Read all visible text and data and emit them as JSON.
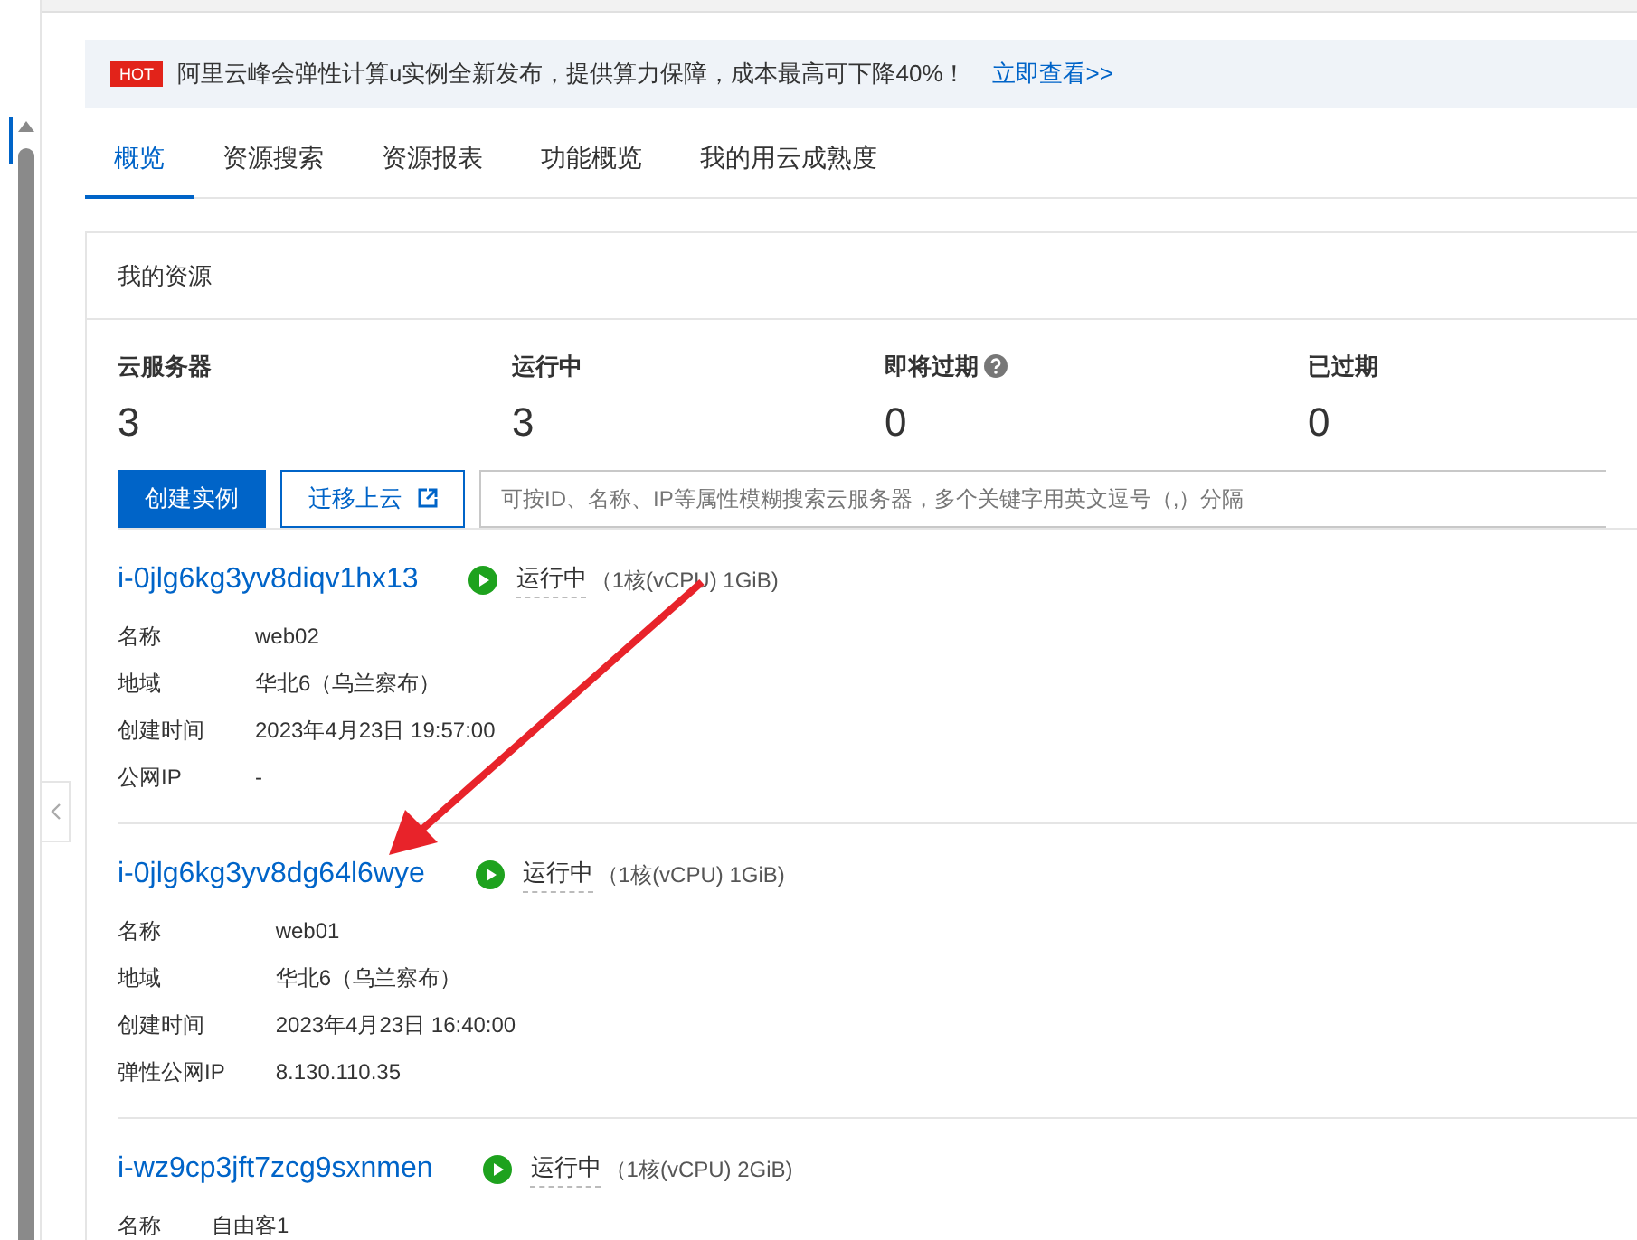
{
  "banner": {
    "badge": "HOT",
    "text": "阿里云峰会弹性计算u实例全新发布，提供算力保障，成本最高可下降40%！",
    "link": "立即查看>>"
  },
  "tabs": [
    {
      "label": "概览",
      "selected": true
    },
    {
      "label": "资源搜索",
      "selected": false
    },
    {
      "label": "资源报表",
      "selected": false
    },
    {
      "label": "功能概览",
      "selected": false
    },
    {
      "label": "我的用云成熟度",
      "selected": false
    }
  ],
  "resources": {
    "title": "我的资源",
    "stats": [
      {
        "label": "云服务器",
        "value": "3",
        "help": false
      },
      {
        "label": "运行中",
        "value": "3",
        "help": false
      },
      {
        "label": "即将过期",
        "value": "0",
        "help": true
      },
      {
        "label": "已过期",
        "value": "0",
        "help": false
      }
    ],
    "buttons": [
      {
        "label": "创建实例",
        "kind": "primary"
      },
      {
        "label": "迁移上云",
        "kind": "external"
      }
    ],
    "search": {
      "placeholder": "可按ID、名称、IP等属性模糊搜索云服务器，多个关键字用英文逗号（,）分隔"
    }
  },
  "instances": [
    {
      "id": "i-0jlg6kg3yv8diqv1hx13",
      "status": {
        "kind": "running",
        "text": "运行中"
      },
      "spec": "（1核(vCPU) 1GiB)",
      "fields": [
        {
          "label": "名称",
          "value": "web02"
        },
        {
          "label": "地域",
          "value": "华北6（乌兰察布）"
        },
        {
          "label": "创建时间",
          "value": "2023年4月23日 19:57:00"
        },
        {
          "label": "公网IP",
          "value": "-"
        }
      ]
    },
    {
      "id": "i-0jlg6kg3yv8dg64l6wye",
      "status": {
        "kind": "running",
        "text": "运行中"
      },
      "spec": "（1核(vCPU) 1GiB)",
      "fields": [
        {
          "label": "名称",
          "value": "web01"
        },
        {
          "label": "地域",
          "value": "华北6（乌兰察布）"
        },
        {
          "label": "创建时间",
          "value": "2023年4月23日 16:40:00"
        },
        {
          "label": "弹性公网IP",
          "value": "8.130.110.35"
        }
      ]
    },
    {
      "id": "i-wz9cp3jft7zcg9sxnmen",
      "status": {
        "kind": "running",
        "text": "运行中"
      },
      "spec": "（1核(vCPU) 2GiB)",
      "fields": [
        {
          "label": "名称",
          "value": "自由客1"
        }
      ]
    }
  ]
}
